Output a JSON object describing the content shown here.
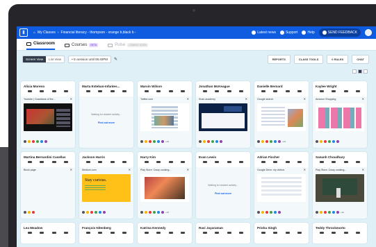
{
  "topbar": {
    "logo": "Ⅱ",
    "breadcrumb": [
      "My Classes",
      "Financial literacy - thompson - orange b,black b -"
    ],
    "latest_news": "Latest news",
    "support": "Support",
    "help": "Help",
    "send_feedback": "SEND FEEDBACK"
  },
  "tabs": [
    {
      "label": "Classroom",
      "active": true
    },
    {
      "label": "Courses",
      "badge": "BETA",
      "active": false
    },
    {
      "label": "Pulse",
      "badge": "COMING SOON",
      "active": false
    }
  ],
  "toolbar": {
    "screen_view": "Screen View",
    "list_view": "List View",
    "session": "• In session until 05:40PM",
    "reports": "REPORTS",
    "class_tools": "CLASS TOOLS",
    "rules": "0 RULES",
    "chat": "CHAT"
  },
  "waiting_text": "Waiting for student activity...",
  "find_out_more": "Find out more",
  "students": [
    {
      "name": "Alicia Moreno",
      "tab": "Youtube | Guardians of the...",
      "thumb": "youtube",
      "extra": ""
    },
    {
      "name": "Marta Esteban-Infantes...",
      "tab": "",
      "thumb": "waiting",
      "extra": ""
    },
    {
      "name": "Marvin Wilson",
      "tab": "Twitter.com",
      "thumb": "twitter",
      "extra": "+12"
    },
    {
      "name": "Jonathan McKeague",
      "tab": "Khan academy",
      "thumb": "khan",
      "extra": ""
    },
    {
      "name": "Danielle Bernard",
      "tab": "Google search",
      "thumb": "search",
      "extra": "+12"
    },
    {
      "name": "Kaylee Wright",
      "tab": "Amazon Shopping",
      "thumb": "amazon",
      "extra": ""
    },
    {
      "name": "Martina Bernardini Casellas",
      "tab": "Block page",
      "thumb": "block",
      "extra": ""
    },
    {
      "name": "Jackson Harris",
      "tab": "Medium.com",
      "thumb": "medium",
      "extra": ""
    },
    {
      "name": "Harry Kim",
      "tab": "Play Store: Crazy cooking...",
      "thumb": "play",
      "extra": "+12"
    },
    {
      "name": "Evan Lewis",
      "tab": "",
      "thumb": "waiting",
      "extra": ""
    },
    {
      "name": "Adrian Fischer",
      "tab": "Google Drive: my videos",
      "thumb": "drive",
      "extra": ""
    },
    {
      "name": "Sananh Choudhary",
      "tab": "Play Store: Crazy cooking...",
      "thumb": "lecture",
      "extra": "+12"
    },
    {
      "name": "Lea Meadow",
      "tab": "",
      "thumb": "none",
      "extra": ""
    },
    {
      "name": "François Nitenberg",
      "tab": "",
      "thumb": "none",
      "extra": ""
    },
    {
      "name": "Katrina Kennedy",
      "tab": "",
      "thumb": "none",
      "extra": ""
    },
    {
      "name": "Ravi Jayaraman",
      "tab": "",
      "thumb": "none",
      "extra": ""
    },
    {
      "name": "Prisha Singh",
      "tab": "",
      "thumb": "none",
      "extra": ""
    },
    {
      "name": "Teddy Throckmorto",
      "tab": "",
      "thumb": "none",
      "extra": ""
    }
  ],
  "colors": {
    "brand": "#0f5ce0",
    "background": "#dff0f7",
    "feedback_button": "#0a3f9e"
  }
}
